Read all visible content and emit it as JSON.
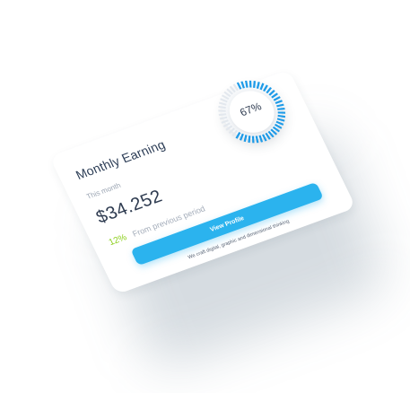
{
  "card": {
    "title": "Monthly Earning",
    "period_label": "This month",
    "amount": "$34.252",
    "change_percent_text": "12%",
    "change_caption": "From previous period",
    "button_label": "View Profile",
    "tagline": "We craft digital, graphic and dimensional thinking"
  },
  "gauge": {
    "label": "67%",
    "value": 0.67,
    "active_color": "#1e9be8",
    "inactive_color": "#e3e8ee"
  },
  "colors": {
    "accent": "#2bb3ee",
    "positive": "#8ccf1b",
    "text_dark": "#2e3b50",
    "text_muted": "#9aa4b2"
  }
}
